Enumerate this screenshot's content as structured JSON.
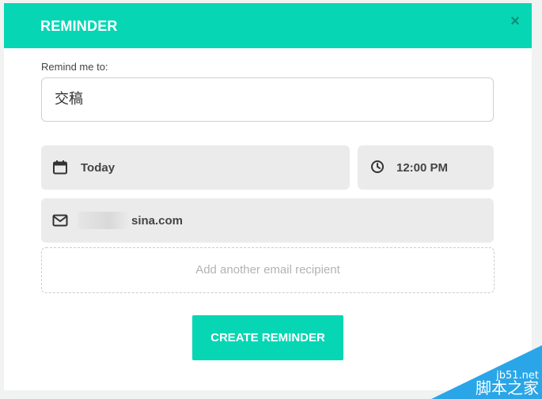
{
  "header": {
    "title": "REMINDER",
    "close_glyph": "×"
  },
  "form": {
    "remind_label": "Remind me to:",
    "remind_value": "交稿",
    "date_icon": "calendar-icon",
    "date_value": "Today",
    "time_icon": "clock-icon",
    "time_value": "12:00 PM",
    "email_icon": "mail-icon",
    "email_value": "sina.com",
    "add_recipient": "Add another email recipient",
    "submit_label": "CREATE REMINDER"
  },
  "watermark": {
    "url": "jb51.net",
    "name": "脚本之家"
  },
  "colors": {
    "accent": "#06d6b4",
    "field_bg": "#ebebeb"
  }
}
